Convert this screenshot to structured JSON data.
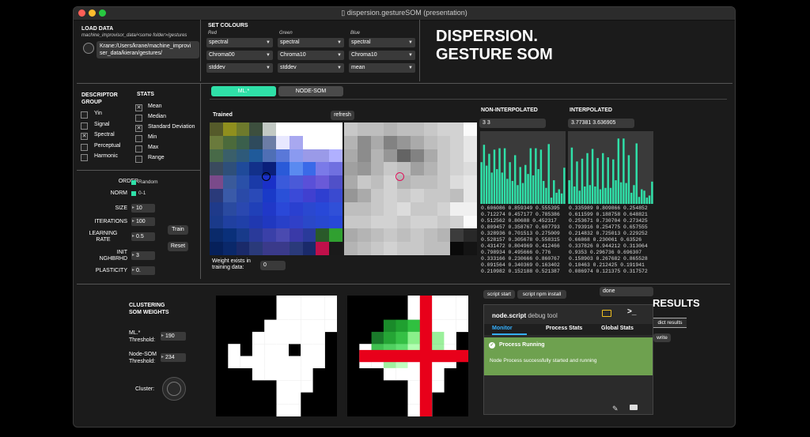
{
  "window": {
    "title": "dispersion.gestureSOM (presentation)"
  },
  "load": {
    "heading": "LOAD DATA",
    "hint": "machine_improvisor_data/<some folder>/gestures",
    "path": "Krane:/Users/krane/machine_improvi\nser_data/kieran/gestures/"
  },
  "colours": {
    "heading": "SET COLOURS",
    "columns": [
      {
        "label": "Red",
        "desc": "spectral",
        "chroma": "Chroma00",
        "stat": "stddev"
      },
      {
        "label": "Green",
        "desc": "spectral",
        "chroma": "Chroma10",
        "stat": "stddev"
      },
      {
        "label": "Blue",
        "desc": "spectral",
        "chroma": "Chroma10",
        "stat": "mean"
      }
    ]
  },
  "brand": {
    "line1": "DISPERSION.",
    "line2": "GESTURE SOM"
  },
  "descriptor": {
    "heading1": "DESCRIPTOR",
    "heading2": "GROUP",
    "items": [
      {
        "label": "Yin",
        "checked": false
      },
      {
        "label": "Signal",
        "checked": false
      },
      {
        "label": "Spectral",
        "checked": true
      },
      {
        "label": "Perceptual",
        "checked": false
      },
      {
        "label": "Harmonic",
        "checked": false
      }
    ]
  },
  "stats": {
    "heading": "STATS",
    "items": [
      {
        "label": "Mean",
        "checked": true
      },
      {
        "label": "Median",
        "checked": false
      },
      {
        "label": "Standard Deviation",
        "checked": true
      },
      {
        "label": "Min",
        "checked": false
      },
      {
        "label": "Max",
        "checked": false
      },
      {
        "label": "Range",
        "checked": false
      }
    ]
  },
  "params": {
    "order_label": "ORDER",
    "order_value": "Random",
    "norm_label": "NORM",
    "norm_value": "0-1",
    "size_label": "SIZE",
    "size": "10",
    "iter_label": "ITERATIONS",
    "iterations": "100",
    "lr_label1": "LEARNING",
    "lr_label2": "RATE",
    "learning_rate": "0.5",
    "init_label1": "INIT",
    "init_label2": "NGHBRHD",
    "init_nghbrhd": "3",
    "plast_label": "PLASTICITY",
    "plasticity": "0.",
    "train": "Train",
    "reset": "Reset"
  },
  "tabs": {
    "tab1": "ML.*",
    "tab2": "NODE-SOM"
  },
  "trained": {
    "label": "Trained",
    "refresh": "refresh",
    "weight_label1": "Weight exists in",
    "weight_label2": "training data:",
    "weight_value": "0"
  },
  "noninterp": {
    "heading": "NON-INTERPOLATED",
    "value": "3 3",
    "matrix": "0.606086 0.859349 0.555395\n0.712274 0.457177 0.785386\n0.512562 0.80688 0.452317\n0.809457 0.358767 0.607793\n0.328936 0.701513 0.275009\n0.528157 0.305678 0.558315\n0.431472 0.804969 0.412466\n0.798934 0.495666 0.776\n0.333166 0.230666 0.860767\n0.091564 0.340369 0.163402\n0.210982 0.152188 0.521387"
  },
  "interp": {
    "heading": "INTERPOLATED",
    "value": "3.77381 3.636905",
    "matrix": "0.335989 0.809866 0.254852\n0.611599 0.188758 0.648821\n0.253671 0.730704 0.273425\n0.793916 0.254775 0.657555\n0.214832 0.725013 0.229252\n0.66868 0.230061 0.63526\n0.337826 0.944212 0.313064\n0.9353 0.296736 0.696307\n0.158903 0.267682 0.865528\n0.10463 0.212425 0.191941\n0.086974 0.121375 0.317572"
  },
  "clustering": {
    "heading1": "CLUSTERING",
    "heading2": "SOM WEIGHTS",
    "ml_label1": "ML.*",
    "ml_label2": "Threshold:",
    "ml_value": "190",
    "node_label1": "Node-SOM",
    "node_label2": "Threshold:",
    "node_value": "234",
    "cluster_label": "Cluster:"
  },
  "node": {
    "script_start": "script start",
    "script_npm": "script npm install",
    "done": "done",
    "tool_title": "node.script",
    "tool_sub": "debug tool",
    "tabs": [
      "Monitor",
      "Process Stats",
      "Global Stats"
    ],
    "status_title": "Process Running",
    "status_msg": "Node Process successfully started and running"
  },
  "results": {
    "heading": "RESULTS",
    "dict": "dict results",
    "write": "write"
  },
  "colors": {
    "accent": "#2fe0a8",
    "panel": "#1b1b1b",
    "cross": "#e8001a"
  }
}
